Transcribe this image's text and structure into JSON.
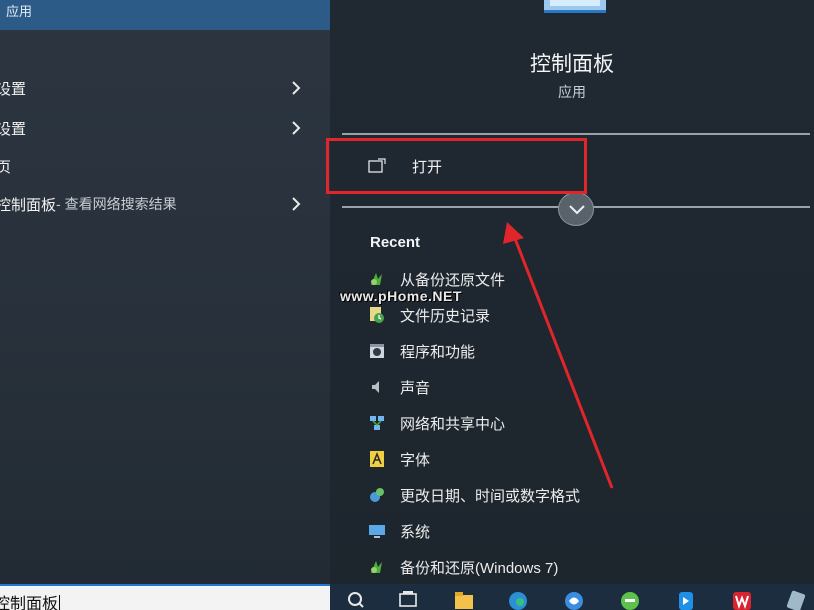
{
  "left_pane": {
    "top_result_subtitle": "应用",
    "results": [
      {
        "label": "设置",
        "subtitle": ""
      },
      {
        "label": "设置",
        "subtitle": ""
      },
      {
        "label": "页",
        "subtitle": ""
      },
      {
        "label": "控制面板",
        "subtitle": " - 查看网络搜索结果"
      }
    ]
  },
  "detail": {
    "title": "控制面板",
    "type": "应用",
    "open_label": "打开",
    "recent_title": "Recent",
    "recent": [
      {
        "label": "从备份还原文件",
        "icon": "backup-restore-icon"
      },
      {
        "label": "文件历史记录",
        "icon": "file-history-icon"
      },
      {
        "label": "程序和功能",
        "icon": "programs-icon"
      },
      {
        "label": "声音",
        "icon": "sound-icon"
      },
      {
        "label": "网络和共享中心",
        "icon": "network-icon"
      },
      {
        "label": "字体",
        "icon": "fonts-icon"
      },
      {
        "label": "更改日期、时间或数字格式",
        "icon": "region-icon"
      },
      {
        "label": "系统",
        "icon": "system-icon"
      },
      {
        "label": "备份和还原(Windows 7)",
        "icon": "backup-icon"
      }
    ]
  },
  "search": {
    "value": "控制面板"
  },
  "watermark": "www.pHome.NET",
  "colors": {
    "highlight": "#e0252b",
    "accent": "#2d5b88"
  }
}
